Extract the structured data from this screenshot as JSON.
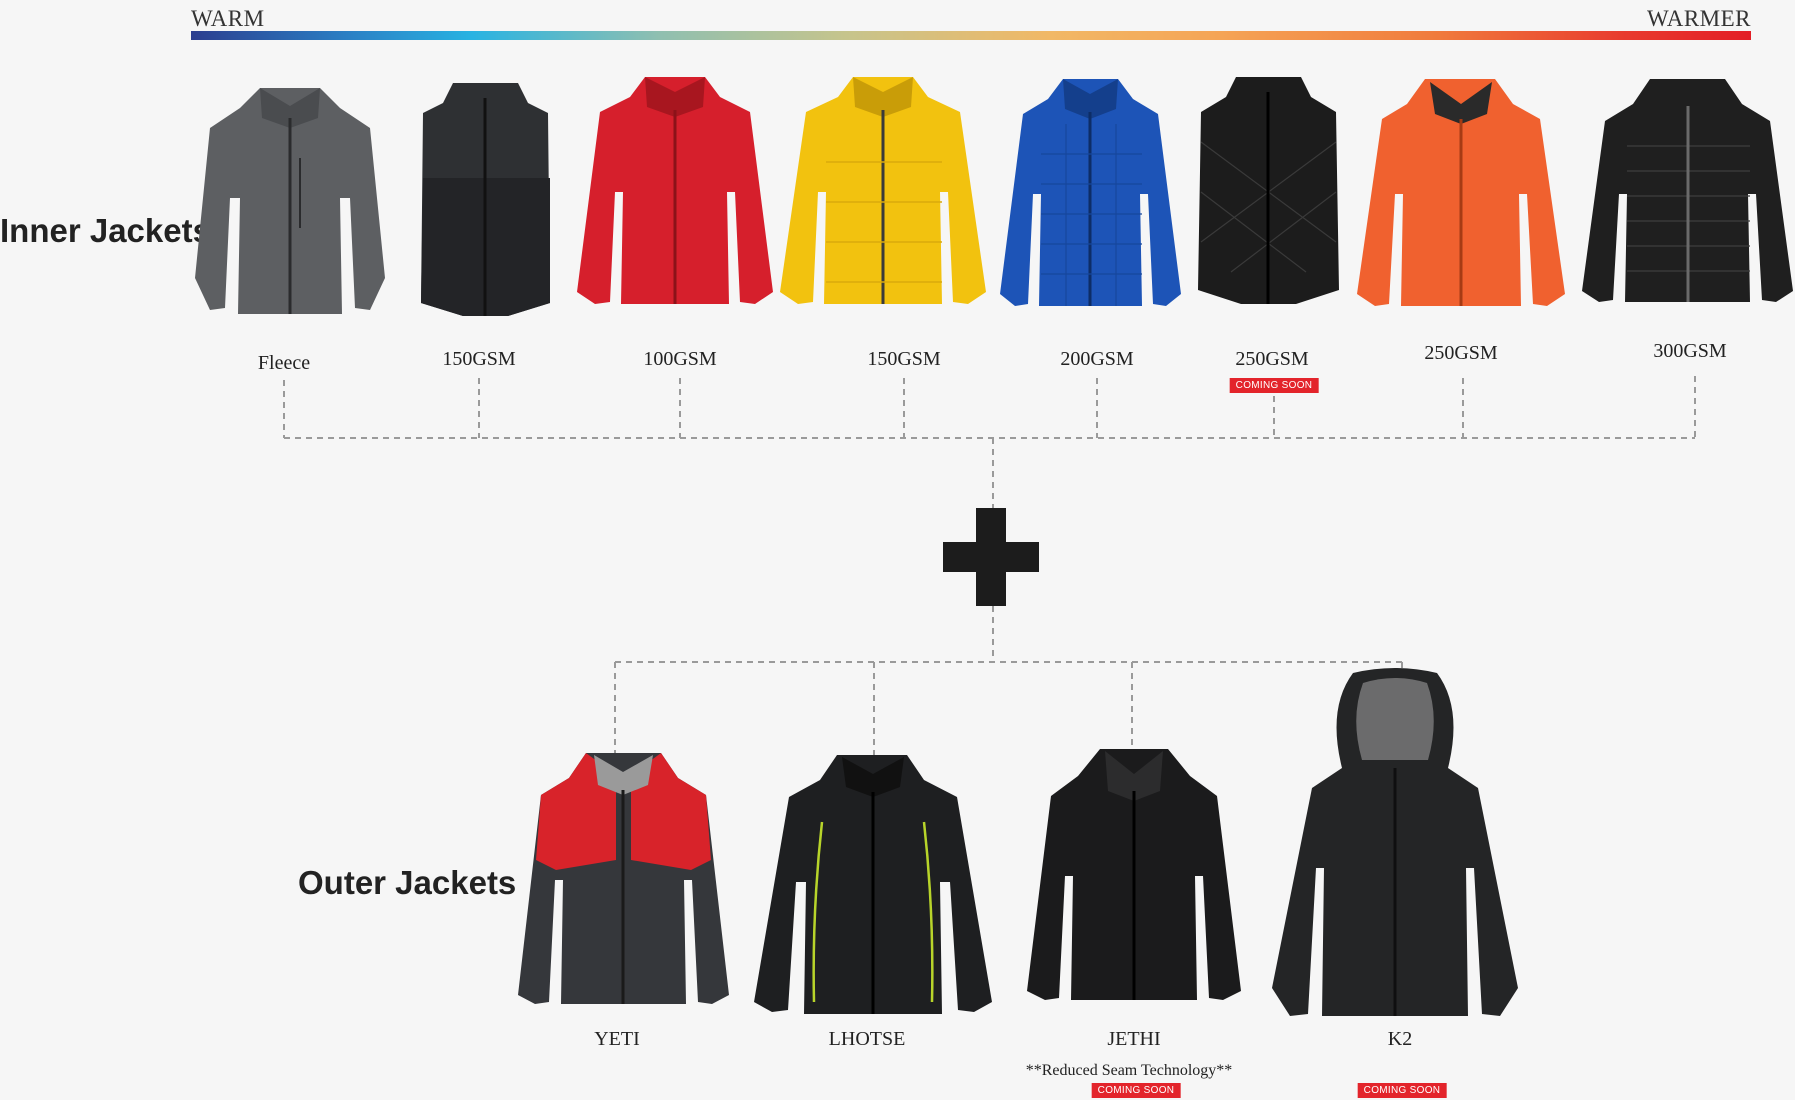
{
  "scale": {
    "left_label": "WARM",
    "right_label": "WARMER"
  },
  "inner": {
    "title": "Inner Jackets",
    "items": [
      {
        "label": "Fleece",
        "color": "#5d5f62",
        "icon": "fleece-jacket"
      },
      {
        "label": "150GSM",
        "color": "#2e3033",
        "icon": "vest"
      },
      {
        "label": "100GSM",
        "color": "#d61f2c",
        "icon": "jacket"
      },
      {
        "label": "150GSM",
        "color": "#f2c20f",
        "icon": "quilted-jacket"
      },
      {
        "label": "200GSM",
        "color": "#1d54b7",
        "icon": "quilted-jacket"
      },
      {
        "label": "250GSM",
        "color": "#1c1c1c",
        "icon": "quilted-vest",
        "badge": "COMING SOON"
      },
      {
        "label": "250GSM",
        "color": "#f0612f",
        "icon": "hooded-jacket"
      },
      {
        "label": "300GSM",
        "color": "#1f1f1f",
        "icon": "hooded-quilted-jacket"
      }
    ]
  },
  "outer": {
    "title": "Outer Jackets",
    "items": [
      {
        "label": "YETI",
        "color": "#35373b",
        "accent": "#d8232a",
        "icon": "shell-jacket"
      },
      {
        "label": "LHOTSE",
        "color": "#1e1f21",
        "accent": "#b8d42a",
        "icon": "shell-jacket"
      },
      {
        "label": "JETHI",
        "color": "#1b1b1c",
        "icon": "hooded-shell-jacket",
        "note": "**Reduced Seam Technology**",
        "badge": "COMING SOON"
      },
      {
        "label": "K2",
        "color": "#242526",
        "icon": "hooded-softshell-jacket",
        "badge": "COMING SOON"
      }
    ]
  }
}
